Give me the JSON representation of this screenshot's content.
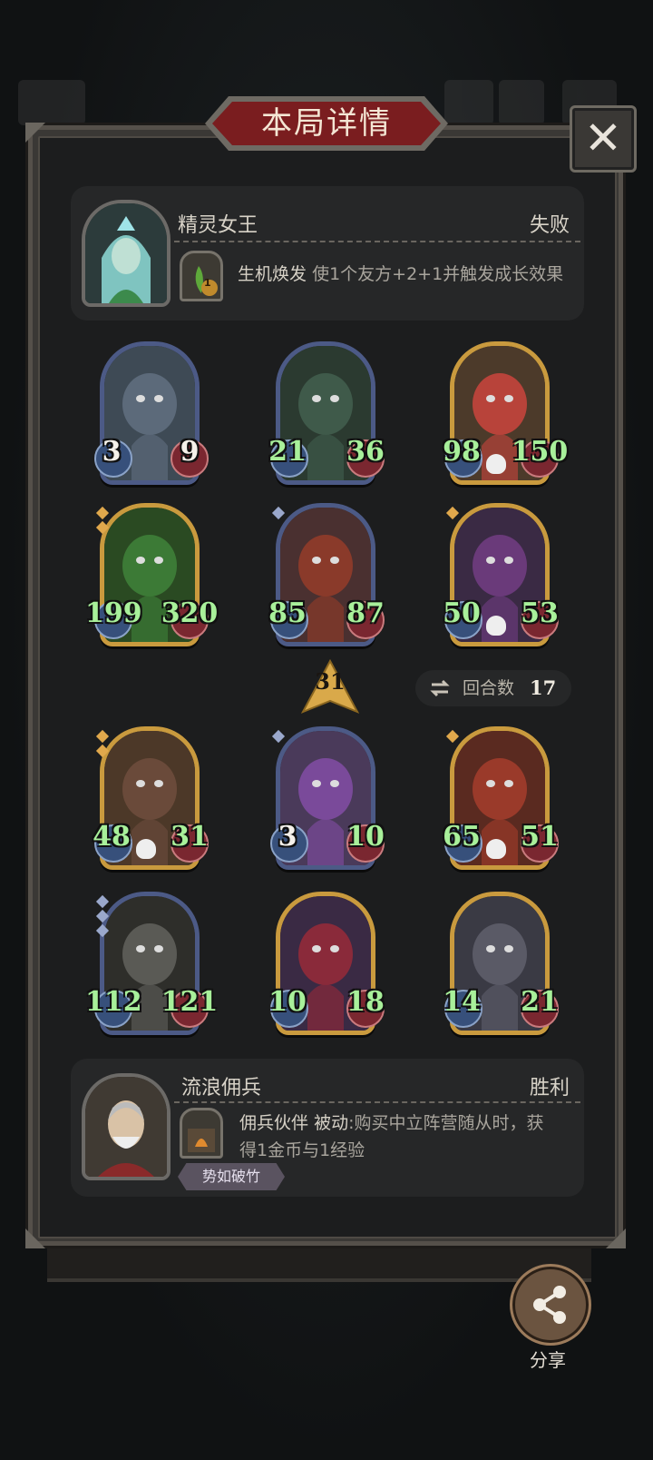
{
  "window": {
    "title": "本局详情",
    "close_icon": "close-icon"
  },
  "opponent": {
    "name": "精灵女王",
    "result": "失败",
    "skill_name": "生机焕发",
    "skill_desc": "使1个友方+2+1并触发成长效果",
    "skill_badge": "1"
  },
  "board_top": [
    {
      "attack": "3",
      "health": "9",
      "frame": "blue"
    },
    {
      "attack": "21",
      "health": "36",
      "frame": "blue"
    },
    {
      "attack": "98",
      "health": "150",
      "frame": "gold"
    },
    {
      "attack": "199",
      "health": "320",
      "frame": "gold"
    },
    {
      "attack": "85",
      "health": "87",
      "frame": "blue"
    },
    {
      "attack": "50",
      "health": "53",
      "frame": "gold"
    }
  ],
  "level": "31",
  "turns": {
    "label": "回合数",
    "value": "17",
    "icon": "swap-arrows-icon"
  },
  "board_bottom": [
    {
      "attack": "48",
      "health": "31",
      "frame": "gold"
    },
    {
      "attack": "3",
      "health": "10",
      "frame": "blue"
    },
    {
      "attack": "65",
      "health": "51",
      "frame": "gold"
    },
    {
      "attack": "112",
      "health": "121",
      "frame": "blue"
    },
    {
      "attack": "10",
      "health": "18",
      "frame": "gold"
    },
    {
      "attack": "14",
      "health": "21",
      "frame": "gold"
    }
  ],
  "player": {
    "name": "流浪佣兵",
    "result": "胜利",
    "skill_name": "佣兵伙伴",
    "skill_type": "被动",
    "skill_desc_1": ":购买中立阵营随从时，获",
    "skill_desc_2": "得1金币与1经验",
    "tag": "势如破竹"
  },
  "share": {
    "label": "分享",
    "icon": "share-icon"
  },
  "colors": {
    "panel": "#3a3835",
    "banner": "#7a1d1f",
    "stat_green": "#a8f09a",
    "frame_gold": "#c99a3e",
    "frame_blue": "#4c5a86"
  }
}
